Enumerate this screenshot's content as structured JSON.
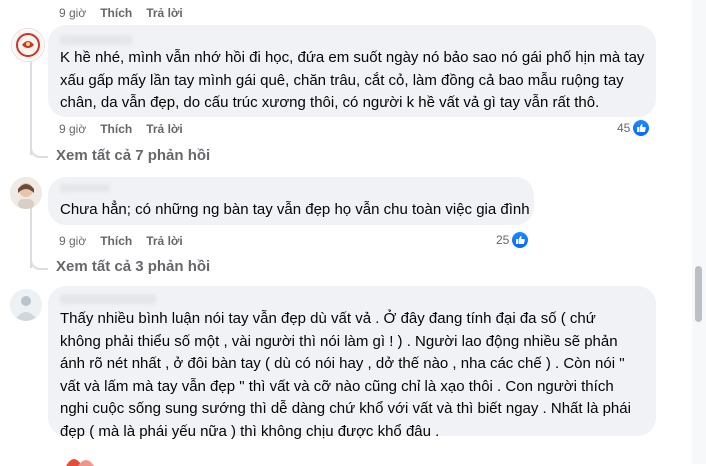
{
  "top_actions": {
    "time": "9 giờ",
    "like": "Thích",
    "reply": "Trả lời"
  },
  "comments": [
    {
      "text": "K hề nhé, mình vẫn nhớ hồi đi học, đứa em suốt ngày nó bảo sao nó gái phố hịn mà tay xấu gấp mấy lần tay mình gái quê, chăn trâu, cắt cỏ, làm đồng cả bao mẫu ruộng tay chân, da vẫn đẹp, do cấu trúc xương thôi, có người k hề vất vả gì tay vẫn rất thô.",
      "time": "9 giờ",
      "like": "Thích",
      "reply": "Trả lời",
      "reaction_count": "45",
      "view_replies": "Xem tất cả 7 phản hồi"
    },
    {
      "text": "Chưa hẳn; có những ng bàn tay vẫn đẹp họ vẫn chu toàn việc gia đình",
      "time": "9 giờ",
      "like": "Thích",
      "reply": "Trả lời",
      "reaction_count": "25",
      "view_replies": "Xem tất cả 3 phản hồi"
    },
    {
      "text": "Thấy nhiều bình luận nói tay vẫn đẹp dù vất vả . Ở đây đang tính đại đa số ( chứ không phải thiểu số một , vài người thì nói làm gì ! ) . Người lao động nhiều sẽ phản ánh rõ nét nhất , ở đôi bàn tay ( dù có nói hay , dở thế nào , nha các chế ) . Còn nói \" vất và lấm mà tay vẫn đẹp \" thì vất và cỡ nào cũng chỉ là xạo thôi . Con người thích nghi cuộc sống sung sướng thì dễ dàng chứ khổ với vất và thì biết ngay . Nhất là phái đẹp ( mà là phái yếu nữa ) thì không chịu được khổ đâu ."
    }
  ],
  "colors": {
    "bubble": "#f0f2f5",
    "meta": "#65676b",
    "like_blue": "#0866ff"
  }
}
